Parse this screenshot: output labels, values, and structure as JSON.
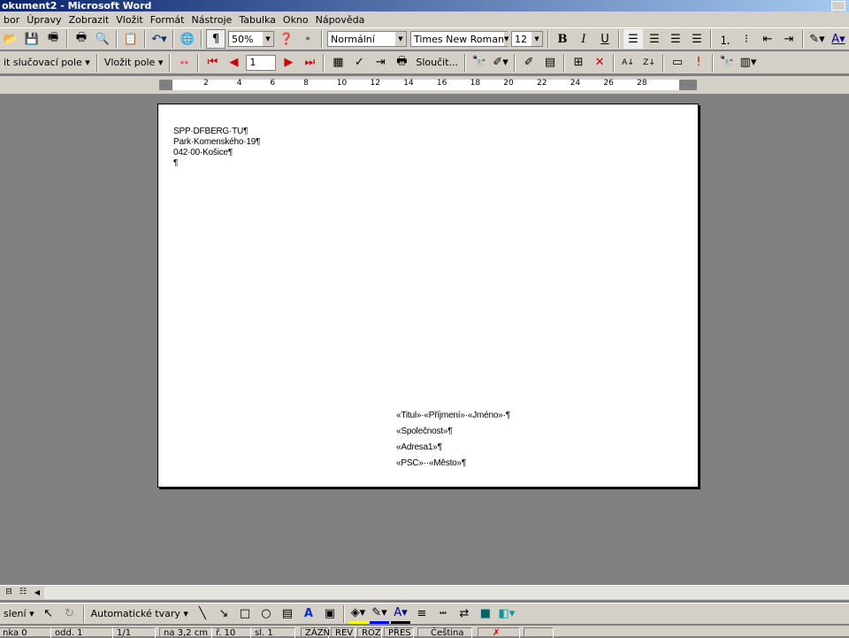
{
  "window": {
    "title": "okument2 - Microsoft Word"
  },
  "menu": [
    "bor",
    "Úpravy",
    "Zobrazit",
    "Vložit",
    "Formát",
    "Nástroje",
    "Tabulka",
    "Okno",
    "Nápověda"
  ],
  "toolbar": {
    "zoom": "50%",
    "style": "Normální",
    "font": "Times New Roman",
    "size": "12"
  },
  "mailmerge": {
    "insert_merge_field": "it slučovací pole",
    "insert_field": "Vložit pole",
    "record": "1",
    "merge": "Sloučit..."
  },
  "ruler": [
    "2",
    "4",
    "6",
    "8",
    "10",
    "12",
    "14",
    "16",
    "18",
    "20",
    "22",
    "24",
    "26",
    "28"
  ],
  "document": {
    "sender": [
      "SPP·DFBERG·TU¶",
      "Park·Komenského·19¶",
      "042·00·Košice¶",
      "¶"
    ],
    "recipient": [
      "«Titul»·«Příjmení»·«Jméno»·¶",
      "«Společnost»¶",
      "«Adresa1»¶",
      "«PSC»··«Město»¶"
    ]
  },
  "drawing": {
    "draw": "slení",
    "autoshapes": "Automatické tvary"
  },
  "status": {
    "page": "nka 0",
    "section": "odd. 1",
    "pages": "1/1",
    "at": "na 3,2 cm",
    "line": "ř. 10",
    "col": "sl. 1",
    "rec": "ZÁZN",
    "trk": "REV",
    "ext": "ROZ",
    "ovr": "PŘES",
    "lang": "Čeština"
  },
  "colors": {
    "title": "#0a246a",
    "face": "#d4d0c8",
    "workspace": "#808080"
  }
}
